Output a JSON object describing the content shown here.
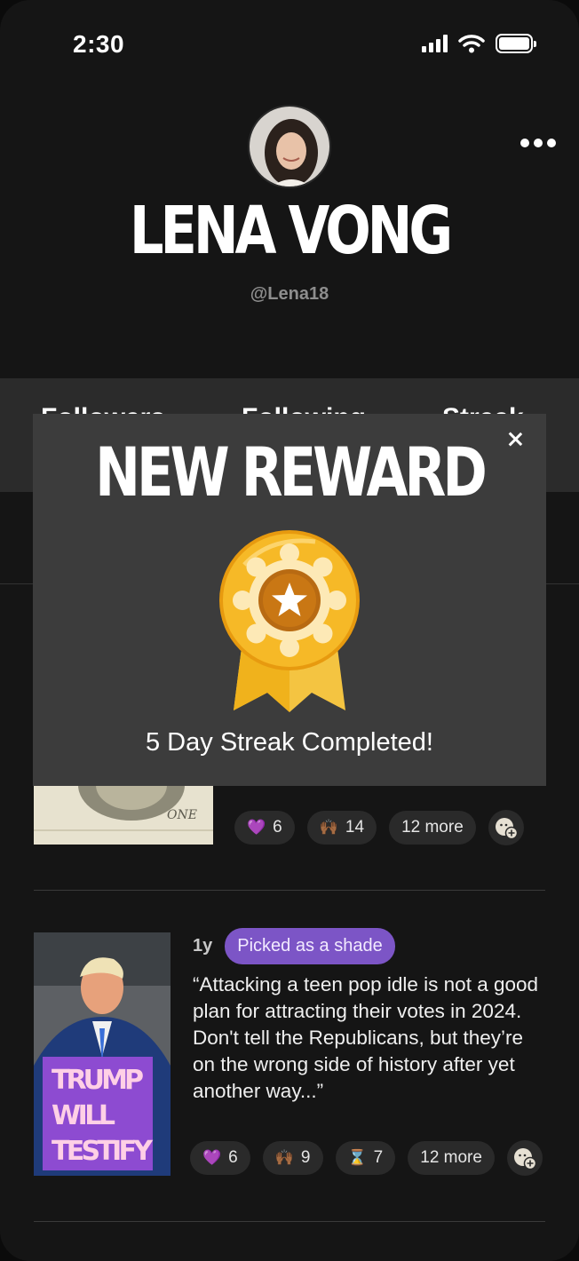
{
  "status_bar": {
    "time": "2:30"
  },
  "profile": {
    "name": "LENA VONG",
    "handle": "@Lena18"
  },
  "stats": {
    "followers_label": "Followers",
    "following_label": "Following",
    "streak_label": "Streak"
  },
  "modal": {
    "title": "NEW REWARD",
    "caption": "5 Day Streak Completed!"
  },
  "feed": {
    "post1": {
      "reactions": [
        {
          "emoji": "💜",
          "count": "6"
        },
        {
          "emoji": "🙌🏾",
          "count": "14"
        }
      ],
      "more": "12 more"
    },
    "post2": {
      "age": "1y",
      "badge": "Picked as a shade",
      "quote": "“Attacking a teen pop idle is not a good plan for attracting their votes in 2024. Don't tell the Republicans, but they’re on the wrong side of history after yet another way...”",
      "thumb_caption": [
        "TRUMP",
        "WILL",
        "TESTIFY"
      ],
      "reactions": [
        {
          "emoji": "💜",
          "count": "6"
        },
        {
          "emoji": "🙌🏾",
          "count": "9"
        },
        {
          "emoji": "⌛",
          "count": "7"
        }
      ],
      "more": "12 more"
    }
  },
  "colors": {
    "background": "#151515",
    "modal": "#3c3c3c",
    "badge": "#7c55c6",
    "medal_gold": "#f0b21c"
  }
}
